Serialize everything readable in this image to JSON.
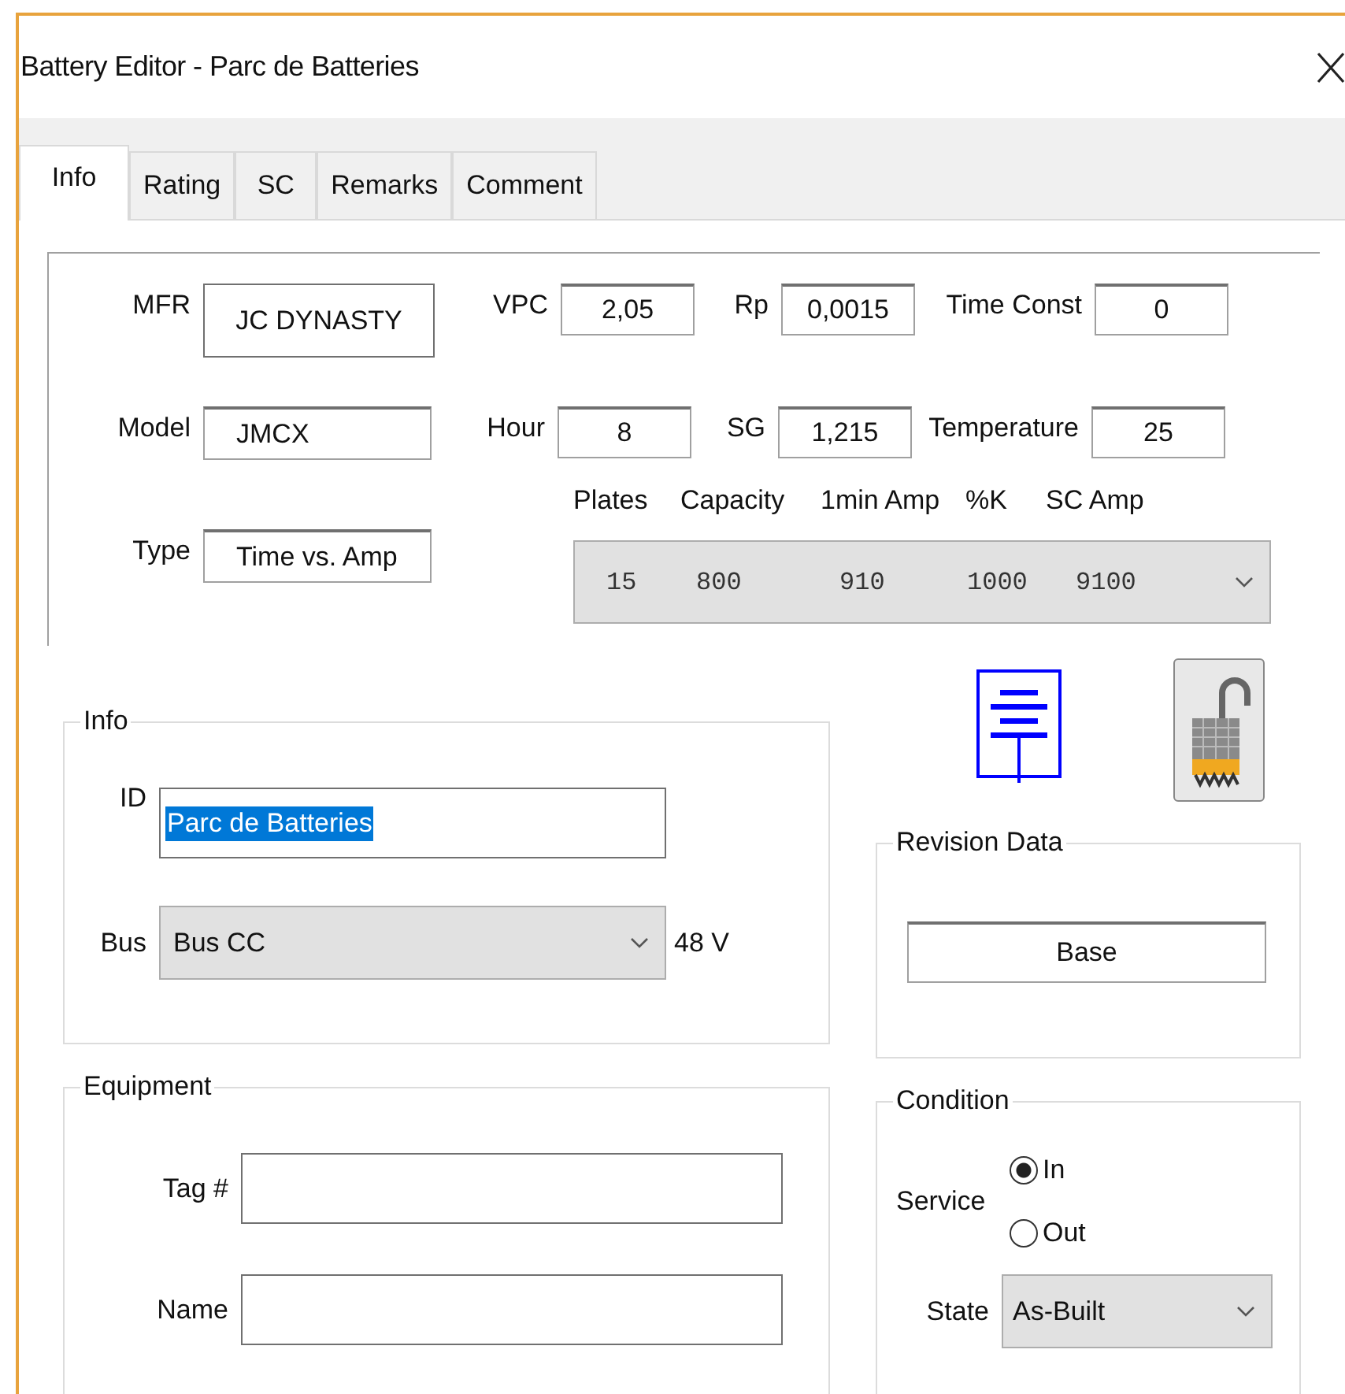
{
  "window": {
    "title": "Battery Editor - Parc de Batteries"
  },
  "tabs": [
    {
      "label": "Info",
      "selected": true
    },
    {
      "label": "Rating",
      "selected": false
    },
    {
      "label": "SC",
      "selected": false
    },
    {
      "label": "Remarks",
      "selected": false
    },
    {
      "label": "Comment",
      "selected": false
    }
  ],
  "battery": {
    "mfr": {
      "label": "MFR",
      "value": "JC DYNASTY"
    },
    "model": {
      "label": "Model",
      "value": "JMCX"
    },
    "type": {
      "label": "Type",
      "value": "Time vs. Amp"
    }
  },
  "parameters": [
    [
      {
        "label": "VPC",
        "value": "2,05"
      },
      {
        "label": "Rp",
        "value": "0,0015"
      },
      {
        "label": "Time Const",
        "value": "0"
      }
    ],
    [
      {
        "label": "Hour",
        "value": "8"
      },
      {
        "label": "SG",
        "value": "1,215"
      },
      {
        "label": "Temperature",
        "value": "25"
      }
    ]
  ],
  "rating_table": {
    "columns": [
      "Plates",
      "Capacity",
      "1min Amp",
      "%K",
      "SC Amp"
    ],
    "values": [
      "15",
      "800",
      "910",
      "1000",
      "9100"
    ]
  },
  "info": {
    "title": "Info",
    "id": {
      "label": "ID",
      "value": "Parc de Batteries",
      "highlighted": true
    },
    "bus": {
      "label": "Bus",
      "value": "Bus CC",
      "voltage": "48 V"
    }
  },
  "equipment": {
    "title": "Equipment",
    "fields": [
      {
        "label": "Tag #"
      },
      {
        "label": "Name"
      }
    ]
  },
  "revision_data": {
    "title": "Revision Data",
    "value": "Base"
  },
  "condition": {
    "title": "Condition",
    "service_label": "Service",
    "service": [
      {
        "label": "In",
        "selected": true
      },
      {
        "label": "Out",
        "selected": false
      }
    ],
    "state": {
      "label": "State",
      "value": "As-Built"
    }
  }
}
